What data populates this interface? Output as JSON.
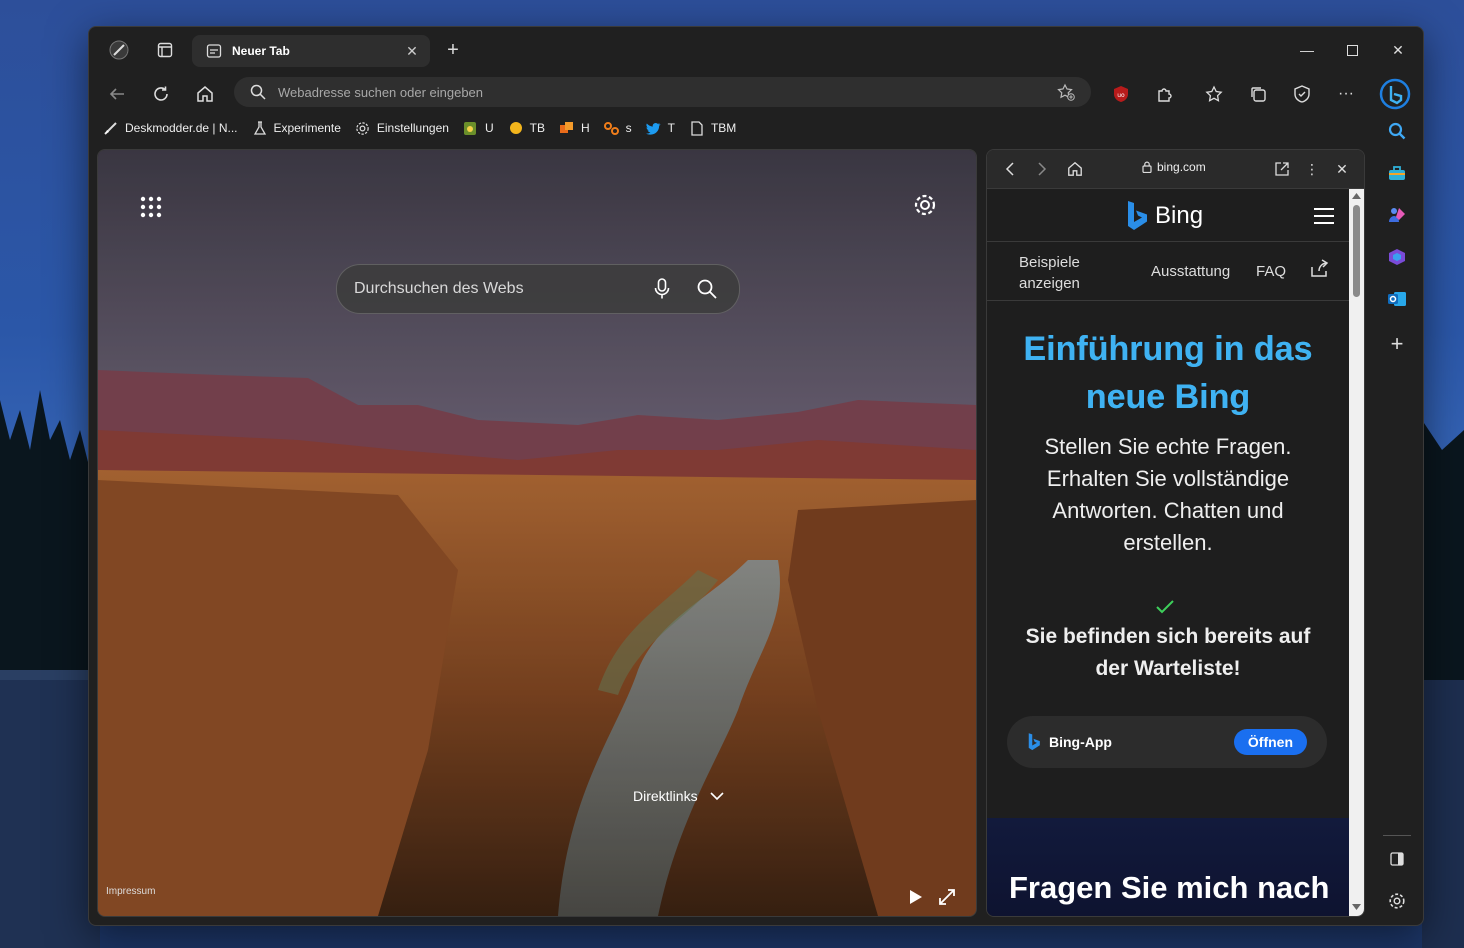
{
  "browser": {
    "tab": {
      "title": "Neuer Tab"
    },
    "address_bar": {
      "placeholder": "Webadresse suchen oder eingeben"
    },
    "favorites": [
      {
        "label": "Deskmodder.de | N...",
        "icon": "pen-icon"
      },
      {
        "label": "Experimente",
        "icon": "flask-icon"
      },
      {
        "label": "Einstellungen",
        "icon": "gear-icon"
      },
      {
        "label": "U",
        "icon": "badge-icon"
      },
      {
        "label": "TB",
        "icon": "circle-yellow-icon"
      },
      {
        "label": "H",
        "icon": "puzzle-icon"
      },
      {
        "label": "s",
        "icon": "glasses-icon"
      },
      {
        "label": "T",
        "icon": "twitter-icon"
      },
      {
        "label": "TBM",
        "icon": "page-icon"
      }
    ]
  },
  "new_tab": {
    "search_placeholder": "Durchsuchen des Webs",
    "quicklinks_label": "Direktlinks",
    "impressum": "Impressum"
  },
  "side_panel": {
    "url": "bing.com",
    "brand": "Bing",
    "nav": {
      "examples": "Beispiele anzeigen",
      "features": "Ausstattung",
      "faq": "FAQ"
    },
    "hero": "Einführung in das neue Bing",
    "subtitle": "Stellen Sie echte Fragen. Erhalten Sie vollständige Antworten. Chatten und erstellen.",
    "waitlist": "Sie befinden sich bereits auf der Warteliste!",
    "app_card": {
      "name": "Bing-App",
      "button": "Öffnen"
    },
    "promo": "Fragen Sie mich nach"
  },
  "colors": {
    "accent": "#3fb2f2",
    "button": "#1a6ff0",
    "check": "#3ecf5b"
  }
}
